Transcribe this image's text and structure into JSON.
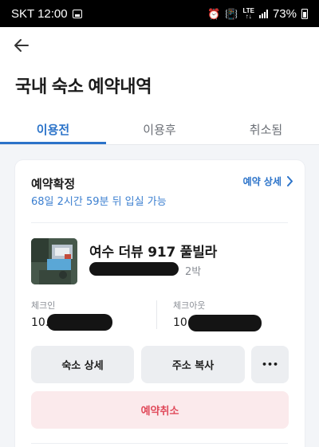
{
  "status_bar": {
    "carrier_time": "SKT 12:00",
    "network": "LTE",
    "battery": "73%"
  },
  "header": {
    "title": "국내 숙소 예약내역"
  },
  "tabs": [
    {
      "label": "이용전",
      "active": true
    },
    {
      "label": "이용후",
      "active": false
    },
    {
      "label": "취소됨",
      "active": false
    }
  ],
  "reservation": {
    "status": "예약확정",
    "countdown": "68일 2시간 59분 뒤 입실 가능",
    "detail_link": "예약 상세",
    "property_name": "여수 더뷰 917 풀빌라",
    "nights": "2박",
    "checkin_label": "체크인",
    "checkin_value": "10.",
    "checkout_label": "체크아웃",
    "checkout_value": "10"
  },
  "actions": {
    "stay_detail": "숙소 상세",
    "copy_address": "주소 복사",
    "more": "•••",
    "cancel": "예약취소"
  },
  "colors": {
    "accent": "#2b73c9",
    "cancel": "#e0495a",
    "cancel_bg": "#fbeaec"
  }
}
